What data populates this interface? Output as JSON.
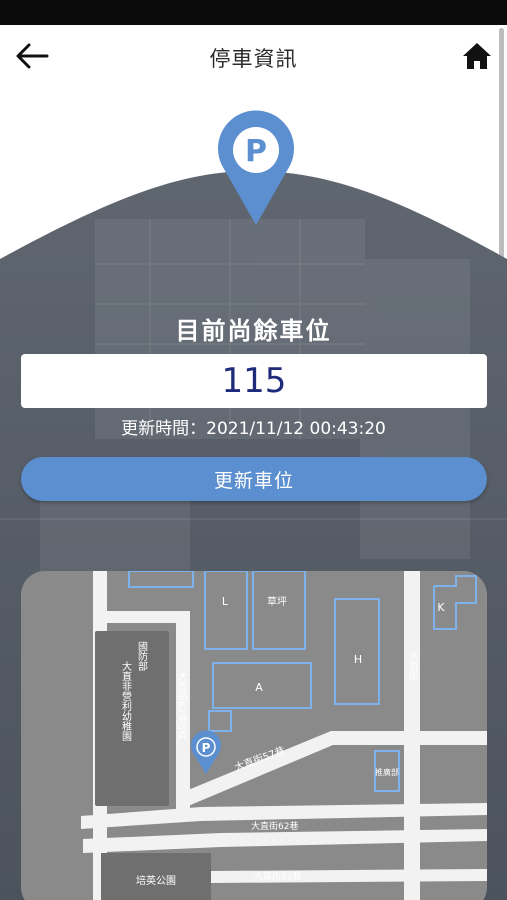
{
  "header": {
    "title": "停車資訊"
  },
  "parking": {
    "remaining_label": "目前尚餘車位",
    "remaining_count": "115",
    "update_time": "更新時間：2021/11/12 00:43:20",
    "refresh_label": "更新車位",
    "pin_letter": "P"
  },
  "map": {
    "buildings": {
      "L": "L",
      "grass": "草坪",
      "H": "H",
      "A": "A",
      "K": "K",
      "promo": "推廣部",
      "defense": "國防部",
      "nursery": "大直非營利幼稚園",
      "park": "培英公園"
    },
    "streets": {
      "lane": "大直路62巷5弄",
      "zhijie": "大直街",
      "alley57": "大直街57巷",
      "alley62": "大直街62巷",
      "alley52": "大直街52巷"
    },
    "pin_letter": "P"
  },
  "colors": {
    "accent": "#5b8fd0",
    "pin": "#5b8fd0",
    "count_text": "#1e2a7a",
    "hero_bg": "#59606b",
    "map_bg": "#8a8a8a"
  },
  "icons": {
    "back": "arrow-left-icon",
    "home": "home-icon",
    "parking": "parking-pin-icon"
  }
}
